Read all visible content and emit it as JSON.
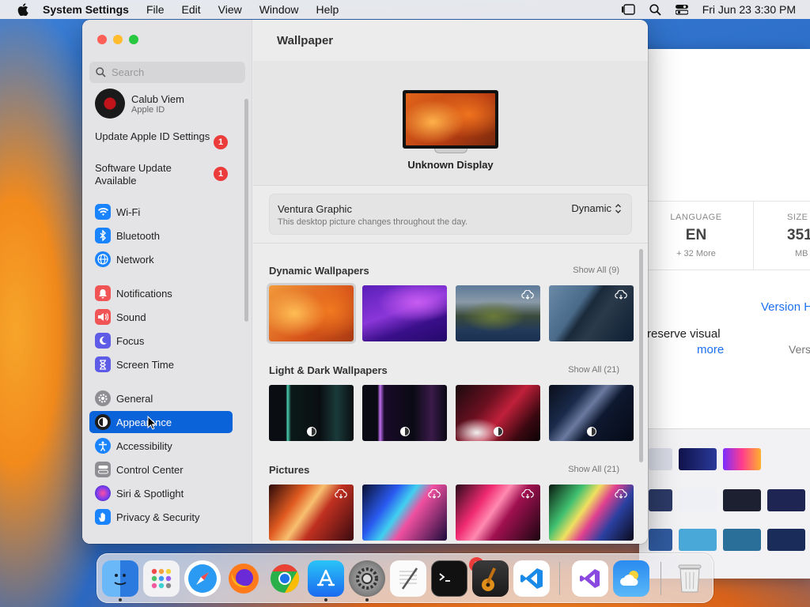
{
  "menubar": {
    "app_name": "System Settings",
    "menus": [
      "File",
      "Edit",
      "View",
      "Window",
      "Help"
    ],
    "datetime": "Fri Jun 23  3:30 PM"
  },
  "background_window": {
    "stats": [
      {
        "label": "LANGUAGE",
        "value": "EN",
        "sub": "+ 32 More"
      },
      {
        "label": "SIZE",
        "value": "351.",
        "sub": "MB"
      }
    ],
    "version_link": "Version H",
    "preserve_text": "reserve visual",
    "more_link": "more",
    "vers_text": "Vers"
  },
  "sidebar": {
    "search_placeholder": "Search",
    "profile": {
      "name": "Calub Viem",
      "sub": "Apple ID"
    },
    "updates": [
      {
        "label": "Update Apple ID Settings",
        "badge": "1"
      },
      {
        "label": "Software Update Available",
        "badge": "1"
      }
    ],
    "items": [
      {
        "label": "Wi-Fi",
        "icon": "wifi-icon",
        "color": "#1a84ff"
      },
      {
        "label": "Bluetooth",
        "icon": "bluetooth-icon",
        "color": "#1a84ff"
      },
      {
        "label": "Network",
        "icon": "globe-icon",
        "color": "#1a84ff"
      },
      {
        "label": "Notifications",
        "icon": "bell-icon",
        "color": "#f05454"
      },
      {
        "label": "Sound",
        "icon": "speaker-icon",
        "color": "#f05454"
      },
      {
        "label": "Focus",
        "icon": "moon-icon",
        "color": "#5e5ce6"
      },
      {
        "label": "Screen Time",
        "icon": "hourglass-icon",
        "color": "#5e5ce6"
      },
      {
        "label": "General",
        "icon": "gear-icon",
        "color": "#8e8e93"
      },
      {
        "label": "Appearance",
        "icon": "appearance-icon",
        "color": "#1c1c1e"
      },
      {
        "label": "Accessibility",
        "icon": "accessibility-icon",
        "color": "#1a84ff"
      },
      {
        "label": "Control Center",
        "icon": "control-center-icon",
        "color": "#8e8e93"
      },
      {
        "label": "Siri & Spotlight",
        "icon": "siri-icon",
        "color": "#7a3cf0"
      },
      {
        "label": "Privacy & Security",
        "icon": "hand-icon",
        "color": "#1a84ff"
      }
    ],
    "selected": "Appearance"
  },
  "content": {
    "title": "Wallpaper",
    "display_name": "Unknown Display",
    "current_wallpaper": {
      "name": "Ventura Graphic",
      "description": "This desktop picture changes throughout the day.",
      "mode": "Dynamic"
    },
    "sections": [
      {
        "title": "Dynamic Wallpapers",
        "show_all": "Show All (9)"
      },
      {
        "title": "Light & Dark Wallpapers",
        "show_all": "Show All (21)"
      },
      {
        "title": "Pictures",
        "show_all": "Show All (21)"
      }
    ]
  },
  "dock": {
    "apps": [
      "Finder",
      "Launchpad",
      "Safari",
      "Firefox",
      "Chrome",
      "App Store",
      "System Settings",
      "TextEdit",
      "Terminal",
      "GarageBand",
      "Visual Studio Code",
      "Visual Studio",
      "Weather",
      "Trash"
    ],
    "settings_badge": "2"
  }
}
